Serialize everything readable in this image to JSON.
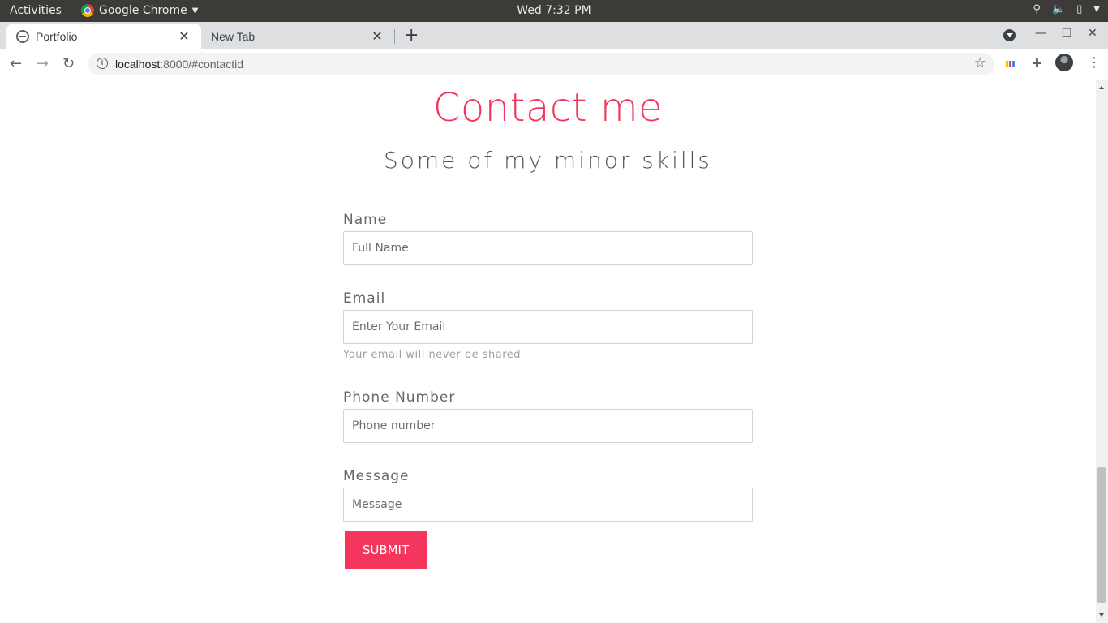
{
  "system": {
    "activities": "Activities",
    "app_name": "Google Chrome",
    "clock": "Wed  7:32 PM"
  },
  "browser": {
    "tabs": [
      {
        "label": "Portfolio",
        "active": true
      },
      {
        "label": "New Tab",
        "active": false
      }
    ],
    "url_host": "localhost",
    "url_rest": ":8000/#contactid"
  },
  "page": {
    "title": "Contact me",
    "subtitle": "Some of my minor skills",
    "form": {
      "name_label": "Name",
      "name_placeholder": "Full Name",
      "email_label": "Email",
      "email_placeholder": "Enter Your Email",
      "email_help": "Your email will never be shared",
      "phone_label": "Phone Number",
      "phone_placeholder": "Phone number",
      "message_label": "Message",
      "message_placeholder": "Message",
      "submit_label": "SUBMIT"
    }
  },
  "colors": {
    "accent": "#f5365c",
    "topbar": "#3c3b37",
    "tabstrip": "#dedfe1"
  },
  "icons": [
    "chrome-icon",
    "tab-favicon-icon",
    "close-icon",
    "plus-icon",
    "tab-search-icon",
    "minimize-icon",
    "restore-icon",
    "back-icon",
    "forward-icon",
    "reload-icon",
    "info-icon",
    "star-icon",
    "extensions-icon",
    "menu-icon"
  ]
}
